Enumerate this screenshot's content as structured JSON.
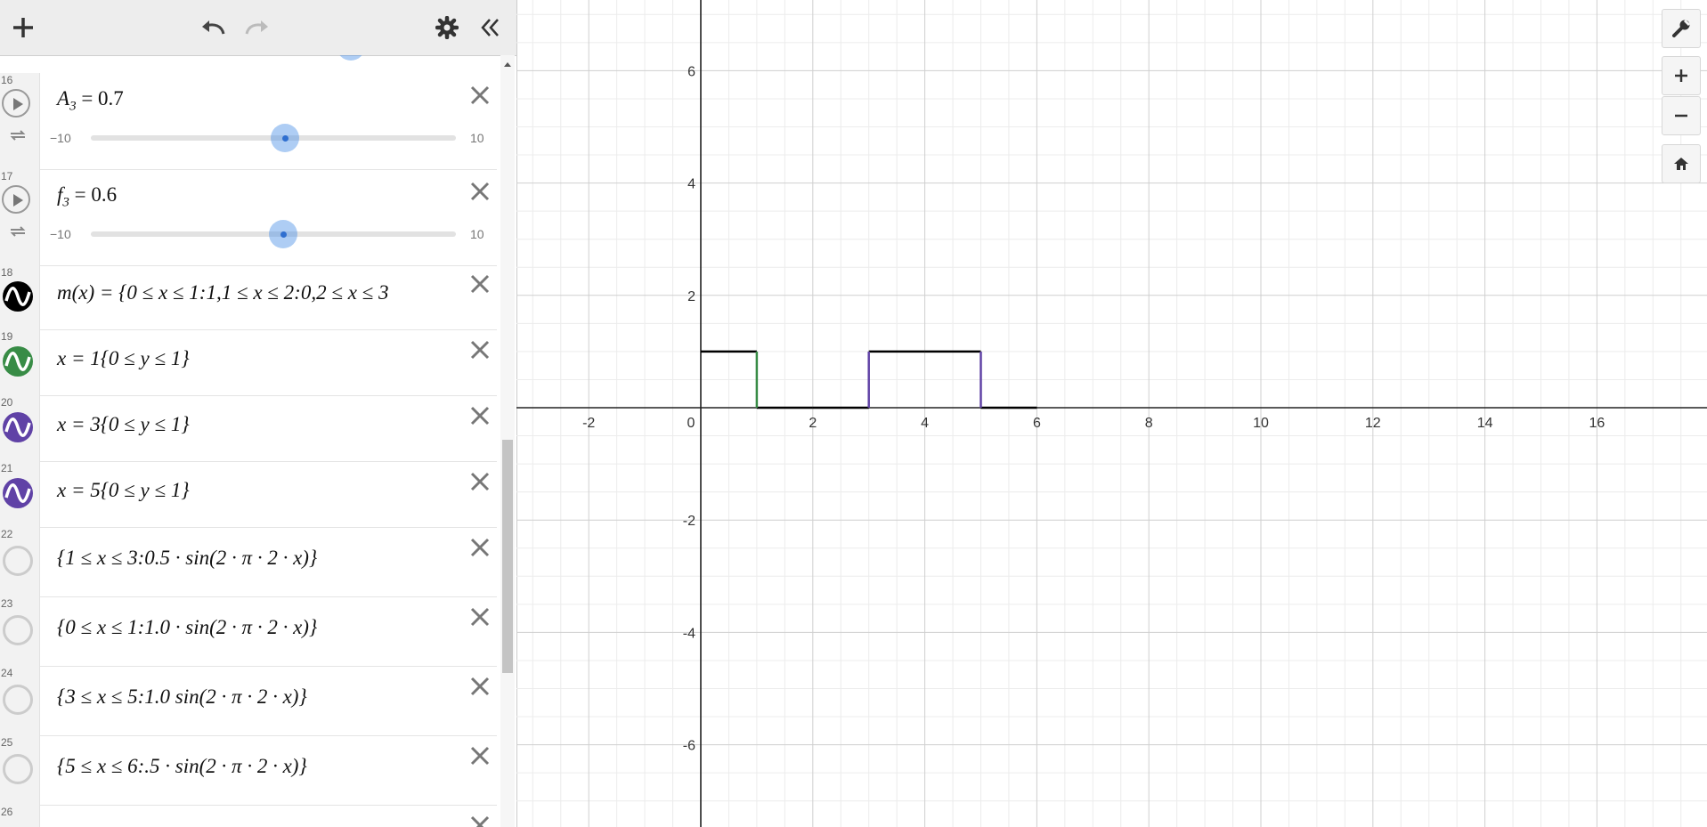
{
  "toolbar": {
    "add": "add-expression",
    "undo": "undo",
    "redo": "redo",
    "settings": "settings",
    "collapse": "collapse-panel"
  },
  "expressions": [
    {
      "num": "16",
      "latex": "A_3 = 0.7",
      "slider": {
        "min": "−10",
        "max": "10",
        "value": 0.7
      }
    },
    {
      "num": "17",
      "latex": "f_3 = 0.6",
      "slider": {
        "min": "−10",
        "max": "10",
        "value": 0.6
      }
    },
    {
      "num": "18",
      "text": "m(x) = {0 ≤ x ≤ 1:1,1 ≤ x ≤ 2:0,2 ≤ x ≤ 3",
      "color": "#000000"
    },
    {
      "num": "19",
      "text": "x = 1{0 ≤ y ≤ 1}",
      "color": "#388c46"
    },
    {
      "num": "20",
      "text": "x = 3{0 ≤ y ≤ 1}",
      "color": "#6042a6"
    },
    {
      "num": "21",
      "text": "x = 5{0 ≤ y ≤ 1}",
      "color": "#6042a6"
    },
    {
      "num": "22",
      "text": "{1 ≤ x ≤ 3:0.5 · sin(2 · π · 2 · x)}"
    },
    {
      "num": "23",
      "text": "{0 ≤ x ≤ 1:1.0 · sin(2 · π · 2 · x)}"
    },
    {
      "num": "24",
      "text": "{3 ≤ x ≤ 5:1.0 sin(2 · π · 2 · x)}"
    },
    {
      "num": "25",
      "text": "{5 ≤ x ≤ 6:.5 · sin(2 · π · 2 · x)}"
    },
    {
      "num": "26"
    }
  ],
  "graph": {
    "x_ticks": [
      "-2",
      "0",
      "2",
      "4",
      "6",
      "8",
      "10",
      "12",
      "14",
      "16"
    ],
    "y_ticks": [
      "6",
      "4",
      "2",
      "-2",
      "-4",
      "-6"
    ]
  },
  "right_toolbar": {
    "wrench": "graph-settings",
    "zoom_in": "zoom-in",
    "zoom_out": "zoom-out",
    "home": "default-viewport"
  },
  "colors": {
    "black": "#000000",
    "green": "#388c46",
    "purple": "#6042a6",
    "slider_blue": "#2f6fd0"
  }
}
